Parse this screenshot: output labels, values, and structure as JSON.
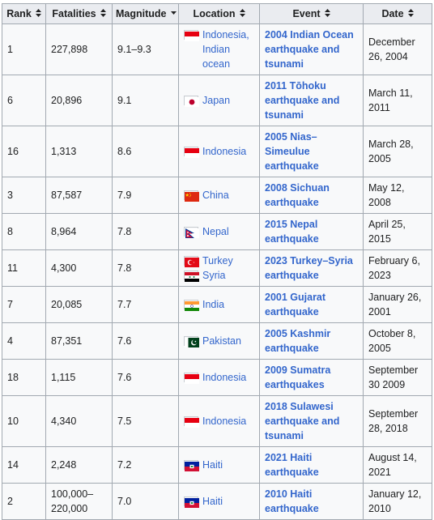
{
  "headers": {
    "rank": "Rank",
    "fatalities": "Fatalities",
    "magnitude": "Magnitude",
    "location": "Location",
    "event": "Event",
    "date": "Date"
  },
  "rows": [
    {
      "rank": "1",
      "fatalities": [
        "227,898"
      ],
      "magnitude": "9.1–9.3",
      "locations": [
        {
          "flag": "indonesia",
          "name": "Indonesia, Indian ocean"
        }
      ],
      "event": "2004 Indian Ocean earthquake and tsunami",
      "date": "December 26, 2004"
    },
    {
      "rank": "6",
      "fatalities": [
        "20,896"
      ],
      "magnitude": "9.1",
      "locations": [
        {
          "flag": "japan",
          "name": "Japan"
        }
      ],
      "event": "2011 Tōhoku earthquake and tsunami",
      "date": "March 11, 2011"
    },
    {
      "rank": "16",
      "fatalities": [
        "1,313"
      ],
      "magnitude": "8.6",
      "locations": [
        {
          "flag": "indonesia",
          "name": "Indonesia"
        }
      ],
      "event": "2005 Nias–Simeulue earthquake",
      "date": "March 28, 2005"
    },
    {
      "rank": "3",
      "fatalities": [
        "87,587"
      ],
      "magnitude": "7.9",
      "locations": [
        {
          "flag": "china",
          "name": "China"
        }
      ],
      "event": "2008 Sichuan earthquake",
      "date": "May 12, 2008"
    },
    {
      "rank": "8",
      "fatalities": [
        "8,964"
      ],
      "magnitude": "7.8",
      "locations": [
        {
          "flag": "nepal",
          "name": "Nepal"
        }
      ],
      "event": "2015 Nepal earthquake",
      "date": "April 25, 2015"
    },
    {
      "rank": "11",
      "fatalities": [
        "4,300"
      ],
      "magnitude": "7.8",
      "locations": [
        {
          "flag": "turkey",
          "name": "Turkey"
        },
        {
          "flag": "syria",
          "name": "Syria"
        }
      ],
      "event": "2023 Turkey–Syria earthquake",
      "date": "February 6, 2023"
    },
    {
      "rank": "7",
      "fatalities": [
        "20,085"
      ],
      "magnitude": "7.7",
      "locations": [
        {
          "flag": "india",
          "name": "India"
        }
      ],
      "event": "2001 Gujarat earthquake",
      "date": "January 26, 2001"
    },
    {
      "rank": "4",
      "fatalities": [
        "87,351"
      ],
      "magnitude": "7.6",
      "locations": [
        {
          "flag": "pakistan",
          "name": "Pakistan"
        }
      ],
      "event": "2005 Kashmir earthquake",
      "date": "October 8, 2005"
    },
    {
      "rank": "18",
      "fatalities": [
        "1,115"
      ],
      "magnitude": "7.6",
      "locations": [
        {
          "flag": "indonesia",
          "name": "Indonesia"
        }
      ],
      "event": "2009 Sumatra earthquakes",
      "date": "September 30 2009"
    },
    {
      "rank": "10",
      "fatalities": [
        "4,340"
      ],
      "magnitude": "7.5",
      "locations": [
        {
          "flag": "indonesia",
          "name": "Indonesia"
        }
      ],
      "event": "2018 Sulawesi earthquake and tsunami",
      "date": "September 28, 2018"
    },
    {
      "rank": "14",
      "fatalities": [
        "2,248"
      ],
      "magnitude": "7.2",
      "locations": [
        {
          "flag": "haiti",
          "name": "Haiti"
        }
      ],
      "event": "2021 Haiti earthquake",
      "date": "August 14, 2021"
    },
    {
      "rank": "2",
      "fatalities": [
        "100,000–",
        "220,000"
      ],
      "magnitude": "7.0",
      "locations": [
        {
          "flag": "haiti",
          "name": "Haiti"
        }
      ],
      "event": "2010 Haiti earthquake",
      "date": "January 12, 2010"
    }
  ],
  "colors": {
    "link": "#3366cc",
    "header_bg": "#eaecf0",
    "cell_bg": "#f8f9fa",
    "border": "#a2a9b1"
  }
}
